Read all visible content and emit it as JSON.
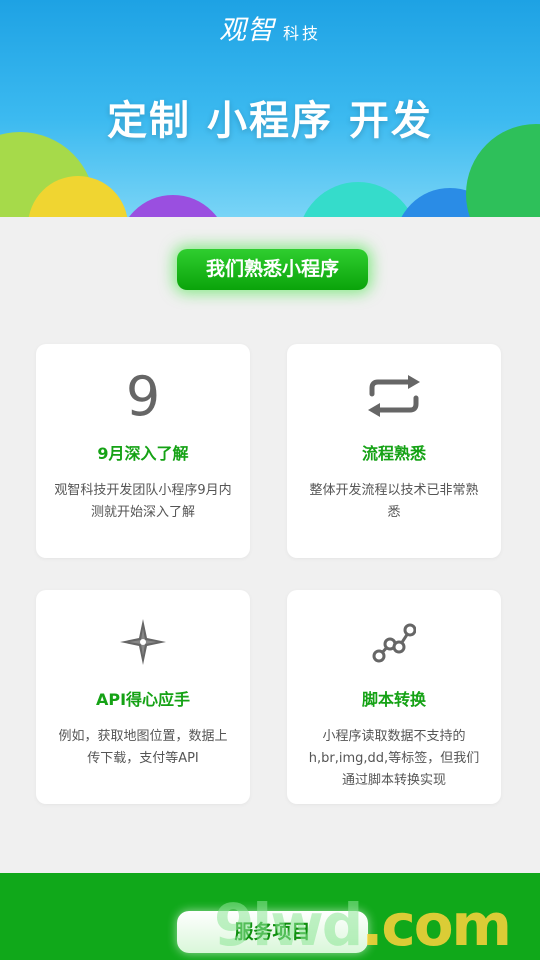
{
  "header": {
    "logo_brand": "观智",
    "logo_sub": "科技",
    "title": "定制 小程序 开发"
  },
  "section": {
    "pill_label": "我们熟悉小程序"
  },
  "cards": [
    {
      "icon": "number-nine-icon",
      "icon_text": "9",
      "title": "9月深入了解",
      "desc": "观智科技开发团队小程序9月内测就开始深入了解"
    },
    {
      "icon": "repeat-arrows-icon",
      "title": "流程熟悉",
      "desc": "整体开发流程以技术已非常熟悉"
    },
    {
      "icon": "compass-star-icon",
      "title": "API得心应手",
      "desc": "例如，获取地图位置，数据上传下载，支付等API"
    },
    {
      "icon": "connected-nodes-icon",
      "title": "脚本转换",
      "desc": "小程序读取数据不支持的h,br,img,dd,等标签，但我们通过脚本转换实现"
    }
  ],
  "footer": {
    "service_label": "服务项目",
    "watermark_text": "9lwd",
    "watermark_suffix": ".com"
  },
  "colors": {
    "accent_green": "#15a215",
    "footer_green": "#10a81a",
    "header_blue": "#1ea2e4"
  }
}
